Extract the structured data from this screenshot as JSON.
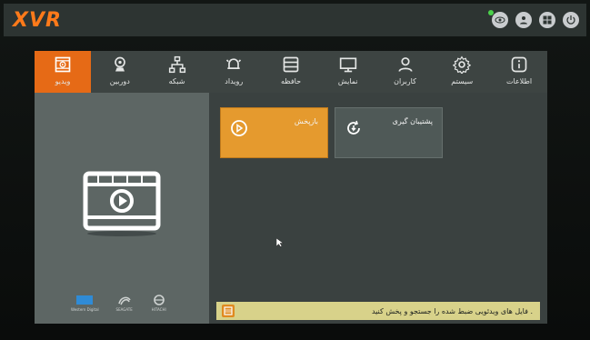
{
  "app": {
    "logo": "XVR"
  },
  "topbar": {
    "icons": [
      {
        "name": "view-icon"
      },
      {
        "name": "user-icon"
      },
      {
        "name": "grid-icon"
      },
      {
        "name": "power-icon"
      }
    ]
  },
  "nav": {
    "items": [
      {
        "label": "ویدیو",
        "icon": "video-icon",
        "active": true
      },
      {
        "label": "دوربین",
        "icon": "camera-icon",
        "active": false
      },
      {
        "label": "شبکه",
        "icon": "network-icon",
        "active": false
      },
      {
        "label": "رویداد",
        "icon": "alarm-icon",
        "active": false
      },
      {
        "label": "حافظه",
        "icon": "storage-icon",
        "active": false
      },
      {
        "label": "نمایش",
        "icon": "display-icon",
        "active": false
      },
      {
        "label": "کاربران",
        "icon": "users-icon",
        "active": false
      },
      {
        "label": "سیستم",
        "icon": "gear-icon",
        "active": false
      },
      {
        "label": "اطلاعات",
        "icon": "info-icon",
        "active": false
      }
    ]
  },
  "tiles": {
    "playback": {
      "label": "بازپخش"
    },
    "backup": {
      "label": "پشتیبان گیری"
    }
  },
  "brands": [
    {
      "label": "Western Digital"
    },
    {
      "label": "SEAGATE"
    },
    {
      "label": "HITACHI"
    }
  ],
  "hint": {
    "text": "فایل های ویدئویی ضبط شده را جستجو و پخش کنید ."
  },
  "colors": {
    "accent": "#e66a16",
    "tile_playback": "#e59a2e",
    "hint_bg": "#d8d28a"
  }
}
